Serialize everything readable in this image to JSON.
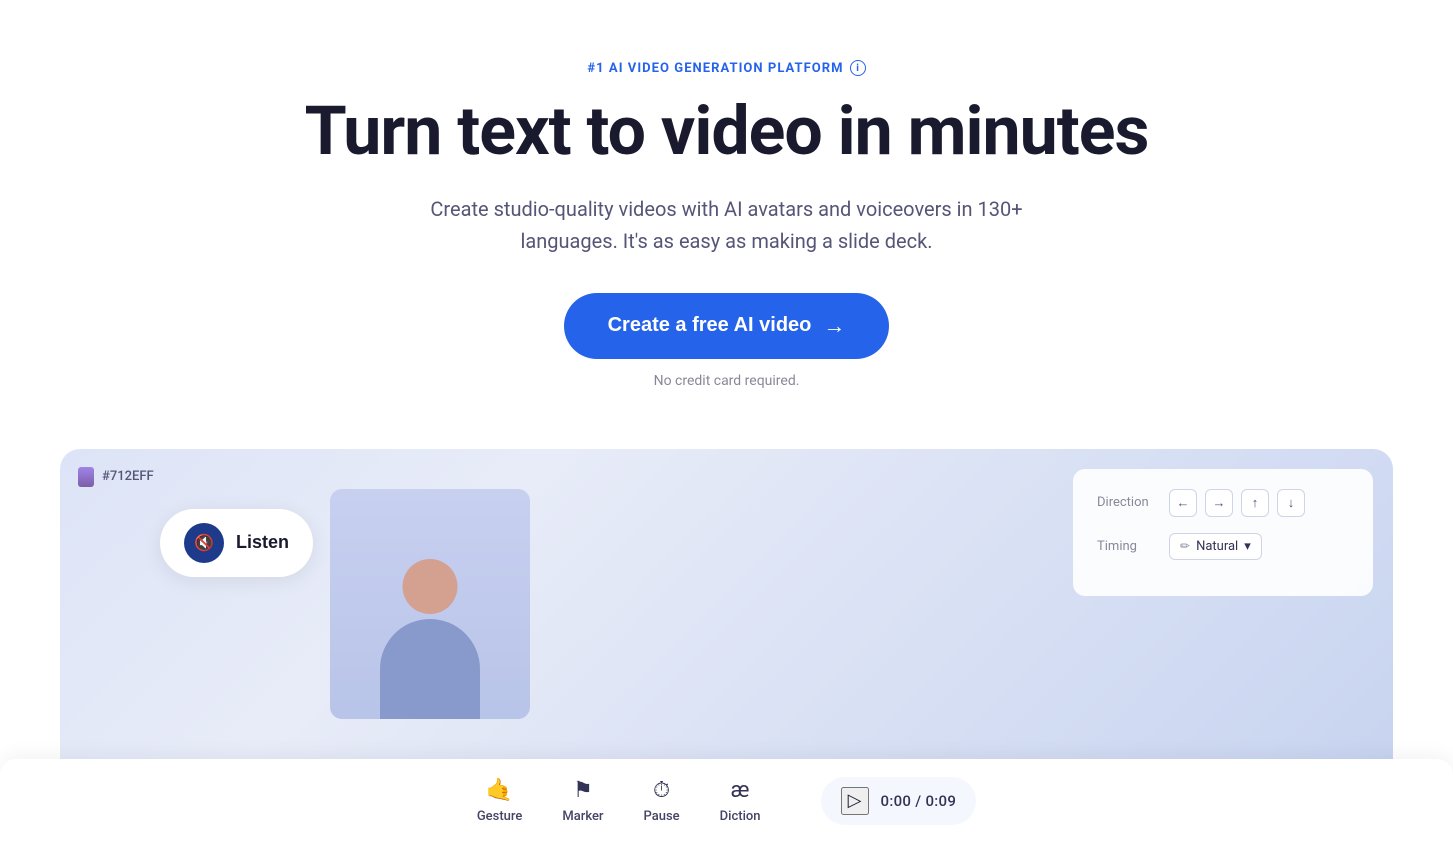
{
  "hero": {
    "badge_text": "#1 AI VIDEO GENERATION PLATFORM",
    "badge_info_label": "i",
    "title": "Turn text to video in minutes",
    "subtitle": "Create studio-quality videos with AI avatars and voiceovers in 130+ languages. It's as easy as making a slide deck.",
    "cta_label": "Create a free AI video",
    "cta_arrow": "→",
    "no_credit_card": "No credit card required."
  },
  "demo": {
    "color_swatch_value": "#712EFF",
    "listen_label": "Listen",
    "direction_label": "Direction",
    "timing_label": "Timing",
    "timing_mode": "Natural",
    "arrows": [
      "←",
      "→",
      "↑",
      "↓"
    ],
    "tools": [
      {
        "icon": "👋",
        "label": "Gesture"
      },
      {
        "icon": "⚑",
        "label": "Marker"
      },
      {
        "icon": "⏱",
        "label": "Pause"
      },
      {
        "icon": "æ",
        "label": "Diction"
      }
    ],
    "time_current": "0:00",
    "time_total": "0:09",
    "time_display": "0:00 / 0:09"
  },
  "colors": {
    "brand_blue": "#2563eb",
    "dark_navy": "#1a1a2e",
    "text_gray": "#555577",
    "light_gray": "#888899"
  }
}
